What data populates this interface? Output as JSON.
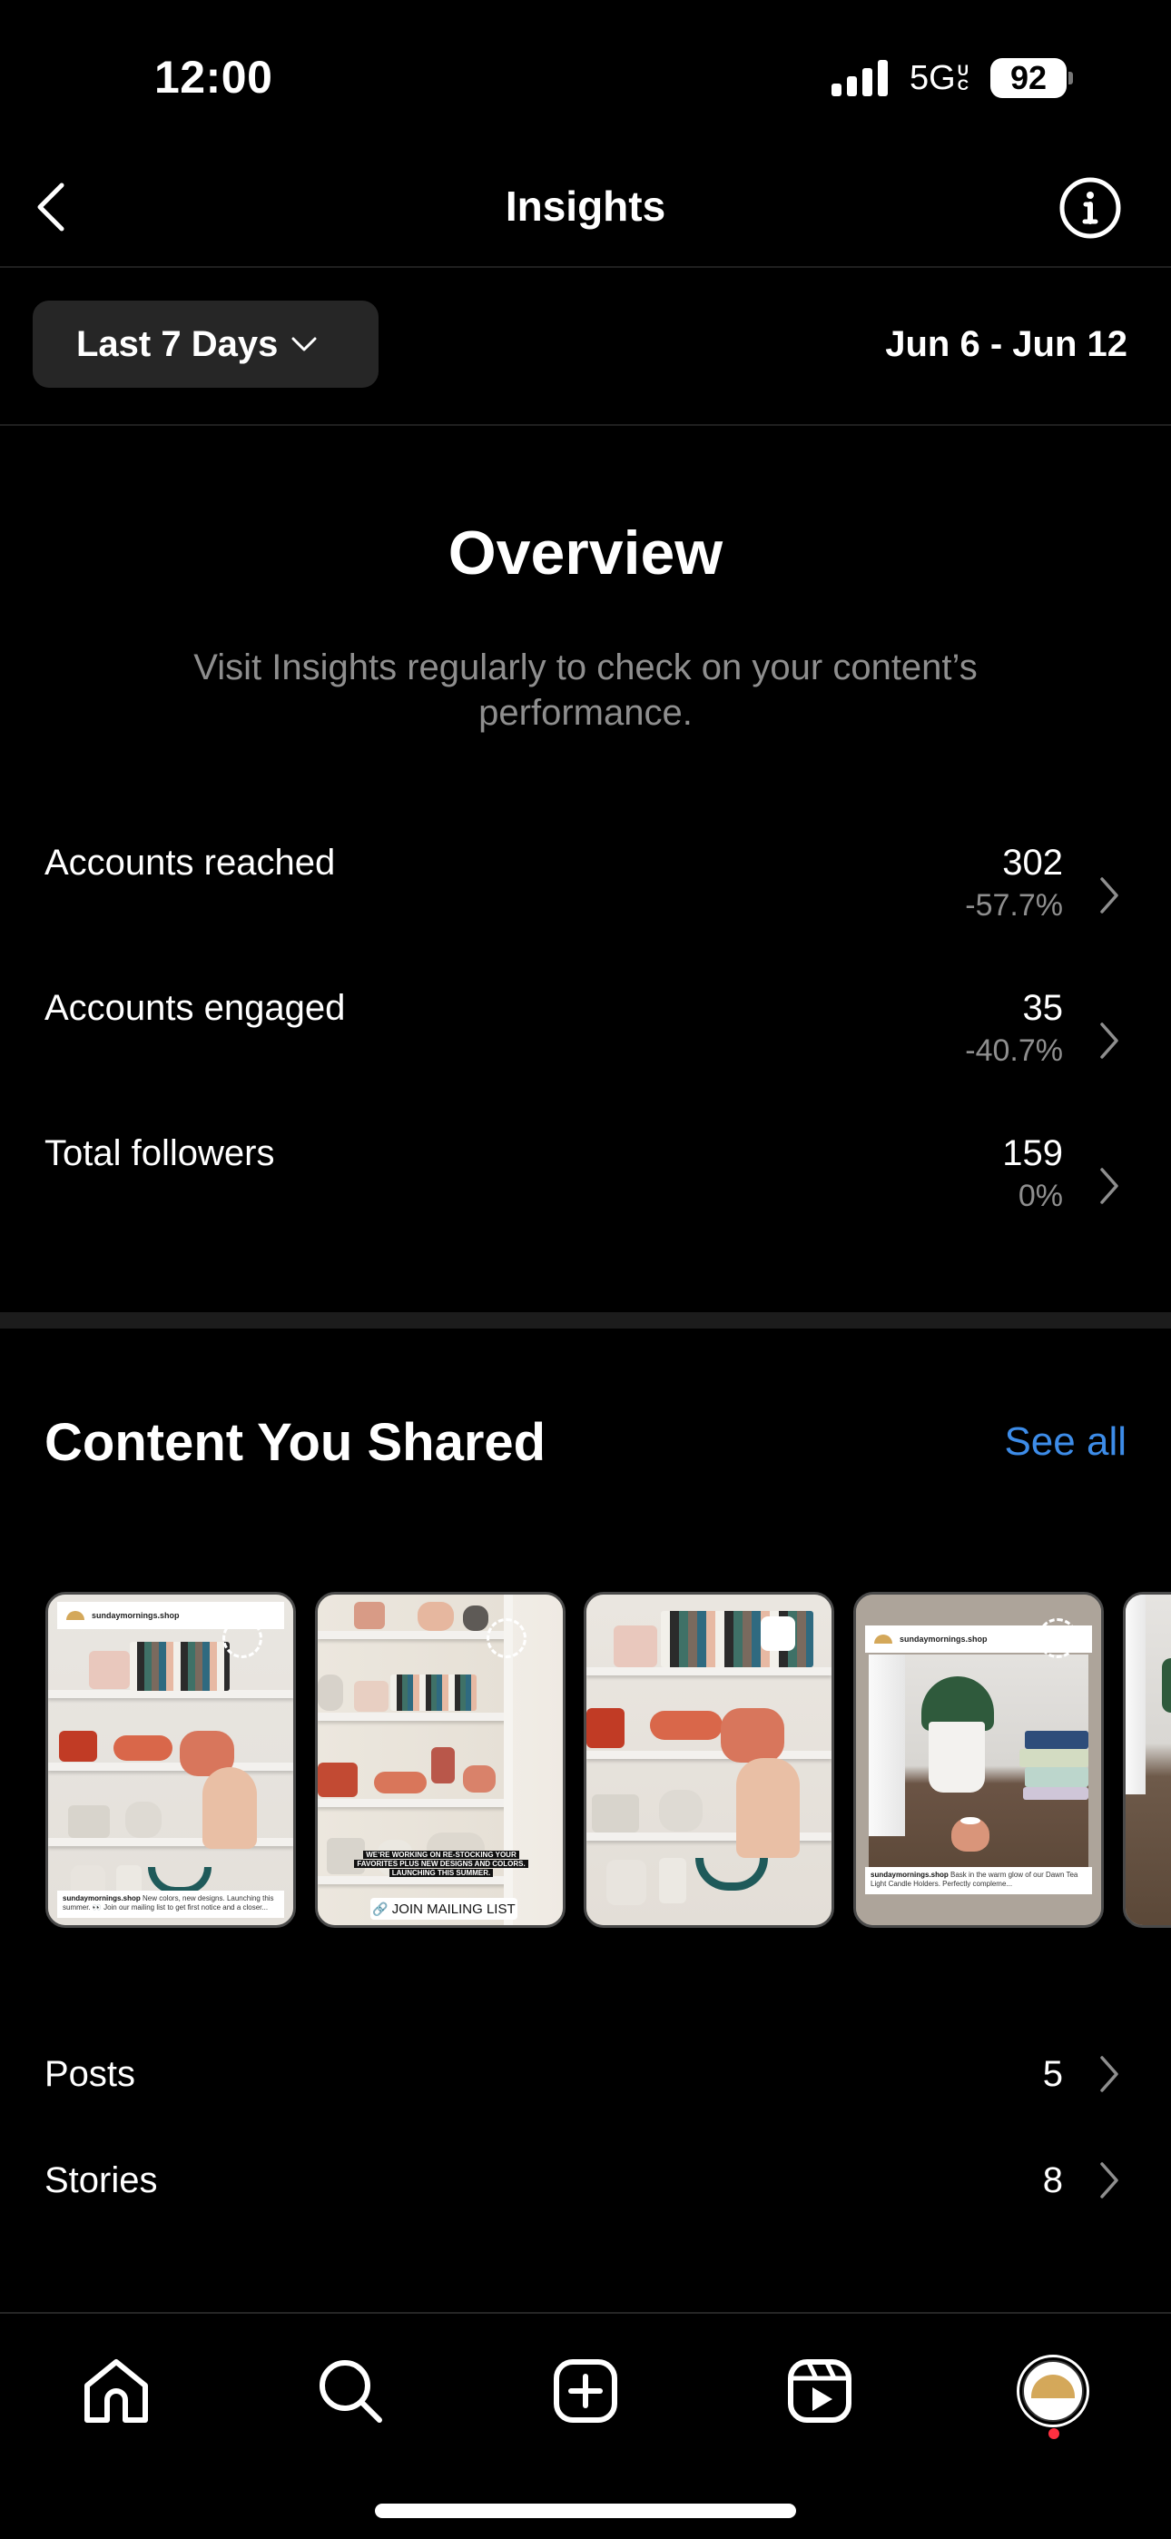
{
  "status_bar": {
    "time": "12:00",
    "network": "5G",
    "network_suffix_top": "U",
    "network_suffix_bottom": "C",
    "battery": "92"
  },
  "header": {
    "title": "Insights",
    "back_icon": "chevron-left-icon",
    "info_icon": "info-icon"
  },
  "filter": {
    "range_label": "Last 7 Days",
    "date_range": "Jun 6 - Jun 12"
  },
  "overview": {
    "title": "Overview",
    "subtitle": "Visit Insights regularly to check on your content’s performance.",
    "metrics": [
      {
        "label": "Accounts reached",
        "value": "302",
        "change": "-57.7%"
      },
      {
        "label": "Accounts engaged",
        "value": "35",
        "change": "-40.7%"
      },
      {
        "label": "Total followers",
        "value": "159",
        "change": "0%"
      }
    ]
  },
  "content_shared": {
    "title": "Content You Shared",
    "see_all": "See all",
    "thumbnails": [
      {
        "type": "story-reshare",
        "username": "sundaymornings.shop",
        "caption_user": "sundaymornings.shop",
        "caption": " New colors, new designs. Launching this summer. 👀 Join our mailing list to get first notice and a closer..."
      },
      {
        "type": "story",
        "overlay_lines": [
          "WE’RE WORKING ON RE-STOCKING YOUR",
          "FAVORITES PLUS NEW DESIGNS AND COLORS.",
          "LAUNCHING THIS SUMMER."
        ],
        "link_sticker": "JOIN MAILING LIST"
      },
      {
        "type": "story"
      },
      {
        "type": "story-reshare",
        "username": "sundaymornings.shop",
        "caption_user": "sundaymornings.shop",
        "caption": " Bask in the warm glow of our Dawn Tea Light Candle Holders. Perfectly compleme..."
      },
      {
        "type": "story"
      }
    ],
    "list": [
      {
        "label": "Posts",
        "value": "5"
      },
      {
        "label": "Stories",
        "value": "8"
      }
    ]
  },
  "tab_bar": {
    "tabs": [
      {
        "name": "home",
        "icon": "home-icon"
      },
      {
        "name": "search",
        "icon": "search-icon"
      },
      {
        "name": "create",
        "icon": "plus-square-icon"
      },
      {
        "name": "reels",
        "icon": "reels-icon"
      },
      {
        "name": "profile",
        "icon": "avatar"
      }
    ]
  },
  "colors": {
    "background": "#000000",
    "link_blue": "#3d8ce8",
    "secondary_text": "#8e8e8e",
    "button_bg": "#262626",
    "notification_red": "#ff3040",
    "brand_gold": "#d4a85a"
  }
}
